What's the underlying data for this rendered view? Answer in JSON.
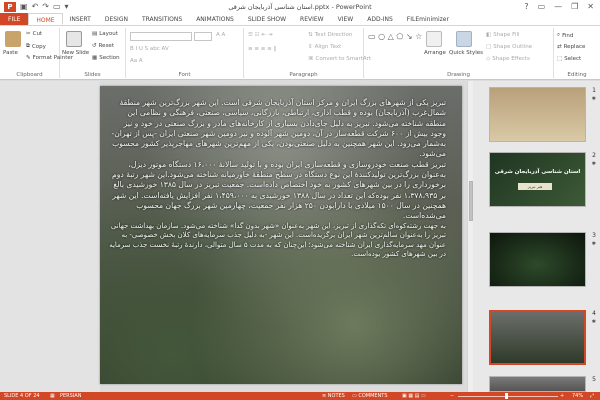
{
  "window": {
    "title": "استان شناسی آذربایجان شرقی.pptx - PowerPoint",
    "app_logo": "P",
    "qat_icons": [
      "save-icon",
      "undo-icon",
      "redo-icon",
      "start-from-beginning-icon",
      "customize-icon"
    ],
    "controls": [
      "?",
      "▭",
      "—",
      "❐",
      "✕"
    ]
  },
  "ribbon": {
    "tabs": [
      "FILE",
      "HOME",
      "INSERT",
      "DESIGN",
      "TRANSITIONS",
      "ANIMATIONS",
      "SLIDE SHOW",
      "REVIEW",
      "VIEW",
      "ADD-INS",
      "FILEminimizer"
    ],
    "active_tab": "HOME",
    "accent": "#d24726",
    "clipboard": {
      "paste": "Paste",
      "cut": "Cut",
      "copy": "Copy",
      "format_painter": "Format Painter",
      "label": "Clipboard"
    },
    "slides": {
      "new_slide": "New Slide",
      "layout": "Layout",
      "reset": "Reset",
      "section": "Section",
      "label": "Slides"
    },
    "font": {
      "label": "Font"
    },
    "paragraph": {
      "text_direction": "Text Direction",
      "align_text": "Align Text",
      "convert_smartart": "Convert to SmartArt",
      "label": "Paragraph"
    },
    "drawing": {
      "arrange": "Arrange",
      "quick_styles": "Quick Styles",
      "shape_fill": "Shape Fill",
      "shape_outline": "Shape Outline",
      "shape_effects": "Shape Effects",
      "label": "Drawing"
    },
    "editing": {
      "find": "Find",
      "replace": "Replace",
      "select": "Select",
      "label": "Editing"
    }
  },
  "slide": {
    "paragraphs": [
      "تبریز یکی از شهرهای بزرگ ایران و مرکز استان آذربایجان شرقی است. این شهر بزرگ‌ترین شهر منطقهٔ شمال‌غرب (آذربایجان) بوده و قطب اداری، ارتباطی، بازرگانی، سیاسی، صنعتی، فرهنگی و نظامی این منطقه شناخته می‌شود. تبریز به دلیل جای‌دادن بسیاری از کارخانه‌های مادر و بزرگ صنعتی در خود و نیز وجود بیش از ۶۰۰ شرکت قطعه‌ساز در آن، دومین شهر آلوده و نیز دومین شهر صنعتی ایران -پس از تهران- به‌شمار می‌رود. این شهر همچنین به دلیل صنعتی‌بودن، یکی از مهم‌ترین شهرهای مهاجرپذیر کشور محسوب می‌شود.",
      "تبریز قطب صنعت خودروسازی و قطعه‌سازی ایران بوده و با تولید سالانهٔ ۱۶،۰۰۰ دستگاه موتور دیزل، به‌عنوان بزرگ‌ترین تولیدکنندهٔ این نوع دستگاه در سطح منطقهٔ خاورمیانه شناخته می‌شود.این شهر رتبهٔ دوم برخورداری را در بین شهرهای کشور به خود اختصاص داده‌است. جمعیت تبریز در سال ۱۳۸۵ خورشیدی بالغ بر ۱،۳۷۸،۹۳۵ نفر بوده‌که این تعداد در سال ۱۳۸۸ خورشیدی به ۱،۴۵۹،۰۰۰ نفر افزایش یافته‌است. این شهر همچنین در سال ۱۵۰۰ میلادی با دارابودن ۲۵۰ هزار نفر جمعیت، چهارمین شهر بزرگ جهان محسوب می‌شده‌است.",
      "به جهت رشته‌کوه‌ای تکه‌گذاری از تبریز، این شهر به‌عنوان «شهر بدون گدا» شناخته می‌شود. سازمان بهداشت جهانی تبریز را به‌عنوان سالم‌ترین شهر ایران برگزیده‌است. این شهر -به دلیل جذب سرمایه‌های کلان بخش خصوصی- به عنوان مهد سرمایه‌گذاری ایران شناخته می‌شود؛ این‌چنان که به مدت ۵ سال متوالی، دارندهٔ رتبهٔ نخست جذب سرمایه در بین شهرهای کشور بوده‌است."
    ]
  },
  "thumbnails": [
    {
      "number": "1",
      "title": "",
      "subtitle": "",
      "colors": [
        "#b9a07a",
        "#d9c9a6"
      ]
    },
    {
      "number": "2",
      "title": "استان شناسی آذربایجان شرقی",
      "subtitle": "هنر تبریز",
      "colors": [
        "#1f3522",
        "#3d5a36"
      ]
    },
    {
      "number": "3",
      "title": "",
      "subtitle": "",
      "colors": [
        "#2d4a2a",
        "#0d160c"
      ]
    },
    {
      "number": "4",
      "title": "",
      "subtitle": "",
      "colors": [
        "#6d7a5c",
        "#2f3a2a"
      ]
    },
    {
      "number": "5",
      "title": "",
      "subtitle": "",
      "colors": [
        "#7a7a7a",
        "#555555"
      ]
    }
  ],
  "status": {
    "slide_of": "SLIDE 4 OF 24",
    "language": "PERSIAN",
    "notes": "NOTES",
    "comments": "COMMENTS",
    "zoom": "74%"
  }
}
